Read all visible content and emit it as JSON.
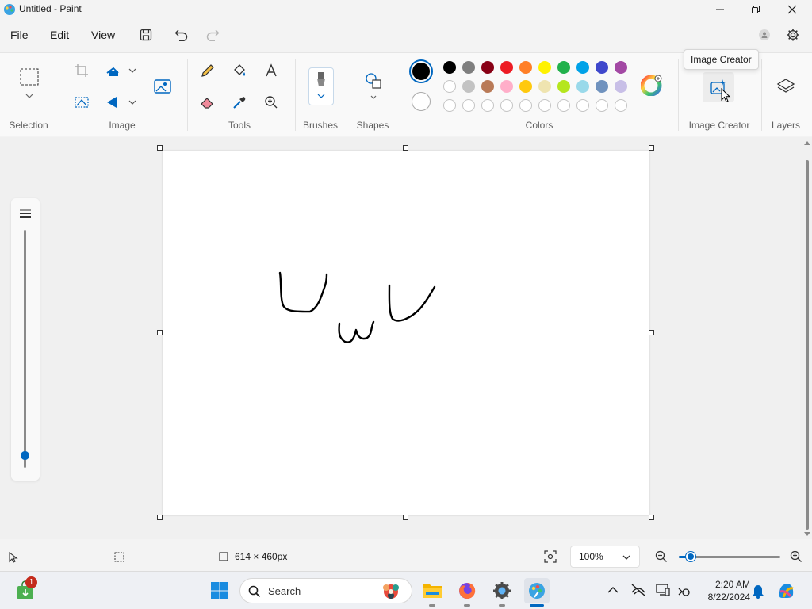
{
  "window": {
    "title": "Untitled - Paint"
  },
  "menu": {
    "file": "File",
    "edit": "Edit",
    "view": "View"
  },
  "ribbon": {
    "groups": {
      "selection": "Selection",
      "image": "Image",
      "tools": "Tools",
      "brushes": "Brushes",
      "shapes": "Shapes",
      "colors": "Colors",
      "image_creator": "Image Creator",
      "layers": "Layers"
    },
    "tooltip": "Image Creator",
    "primary_color": "#000000",
    "secondary_color": "#ffffff",
    "palette_row1": [
      "#000000",
      "#7f7f7f",
      "#880015",
      "#ed1c24",
      "#ff7f27",
      "#fff200",
      "#22b14c",
      "#00a2e8",
      "#3f48cc",
      "#a349a4"
    ],
    "palette_row2": [
      "#ffffff",
      "#c3c3c3",
      "#b97a57",
      "#ffaec9",
      "#ffc90e",
      "#efe4b0",
      "#b5e61d",
      "#99d9ea",
      "#7092be",
      "#c8bfe7"
    ],
    "palette_row3_empty_count": 10
  },
  "canvas": {
    "background": "#ffffff",
    "stroke_color": "#000000"
  },
  "brush_size_fraction": 0.05,
  "status": {
    "dimensions": "614 × 460px",
    "zoom": "100%",
    "zoom_fraction": 0.12
  },
  "taskbar": {
    "search_placeholder": "Search",
    "time": "2:20 AM",
    "date": "8/22/2024",
    "store_badge": "1"
  },
  "colors": {
    "accent": "#0067c0"
  }
}
